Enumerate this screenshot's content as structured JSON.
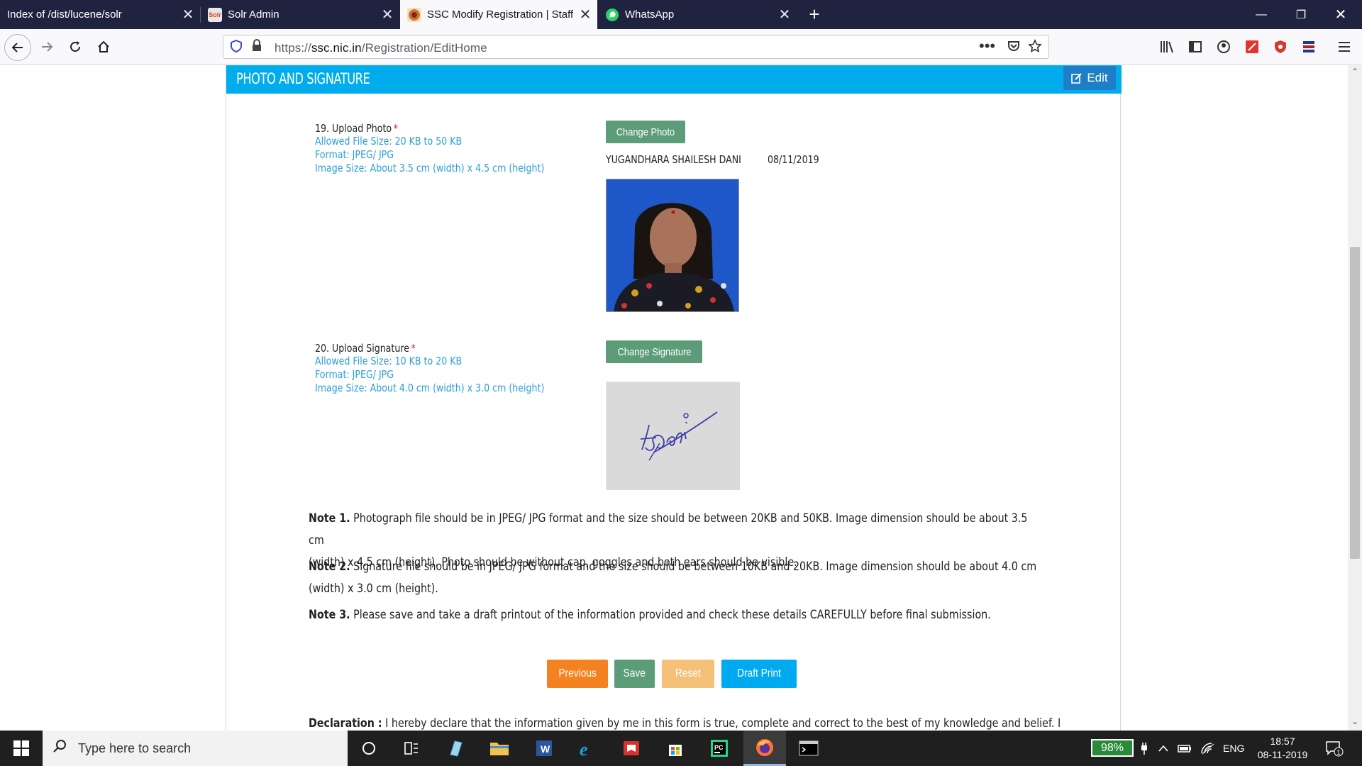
{
  "browser": {
    "tabs": [
      {
        "title": "Index of /dist/lucene/solr"
      },
      {
        "title": "Solr Admin",
        "favicon_text": "Solr"
      },
      {
        "title": "SSC Modify Registration | Staff"
      },
      {
        "title": "WhatsApp"
      }
    ],
    "url_prefix": "https://",
    "url_host": "ssc.nic.in",
    "url_path": "/Registration/EditHome"
  },
  "panel": {
    "title": "PHOTO AND SIGNATURE",
    "edit_label": "Edit"
  },
  "photo_section": {
    "label": "19. Upload Photo",
    "hints": [
      "Allowed File Size: 20 KB to 50 KB",
      "Format: JPEG/ JPG",
      "Image Size: About 3.5 cm (width) x 4.5 cm (height)"
    ],
    "button": "Change Photo",
    "name": "YUGANDHARA SHAILESH DANI",
    "date": "08/11/2019"
  },
  "signature_section": {
    "label": "20. Upload Signature",
    "hints": [
      "Allowed File Size: 10 KB to 20 KB",
      "Format: JPEG/ JPG",
      "Image Size: About 4.0 cm (width) x 3.0 cm (height)"
    ],
    "button": "Change Signature"
  },
  "notes": [
    {
      "title": "Note 1.",
      "text": "Photograph file should be in JPEG/ JPG format and the size should be between 20KB and 50KB. Image dimension should be about 3.5 cm",
      "text2": "(width) x 4.5 cm (height). Photo should be without cap, goggles and both ears should be visible."
    },
    {
      "title": "Note 2.",
      "text": "Signature file should be in JPEG/ JPG format and the size should be between 10KB and 20KB. Image dimension should be about 4.0 cm",
      "text2": "(width) x 3.0 cm (height)."
    },
    {
      "title": "Note 3.",
      "text": "Please save and take a draft printout of the information provided and check these details CAREFULLY before final submission."
    }
  ],
  "actions": {
    "previous": "Previous",
    "save": "Save",
    "reset": "Reset",
    "draft_print": "Draft Print"
  },
  "declaration": {
    "title": "Declaration :",
    "text": "I hereby declare that the information given by me in this form is true, complete and correct to the best of my knowledge and belief. I"
  },
  "taskbar": {
    "search_placeholder": "Type here to search",
    "battery": "98%",
    "language": "ENG",
    "time": "18:57",
    "date": "08-11-2019",
    "notification_count": "1"
  },
  "colors": {
    "header_blue": "#00acec",
    "edit_blue": "#1e7fc8",
    "green_btn": "#5c9c78",
    "previous_orange": "#f58220",
    "reset_orange": "#f5c078",
    "draft_blue": "#00aaf0",
    "hint_blue": "#2d9fd9"
  }
}
